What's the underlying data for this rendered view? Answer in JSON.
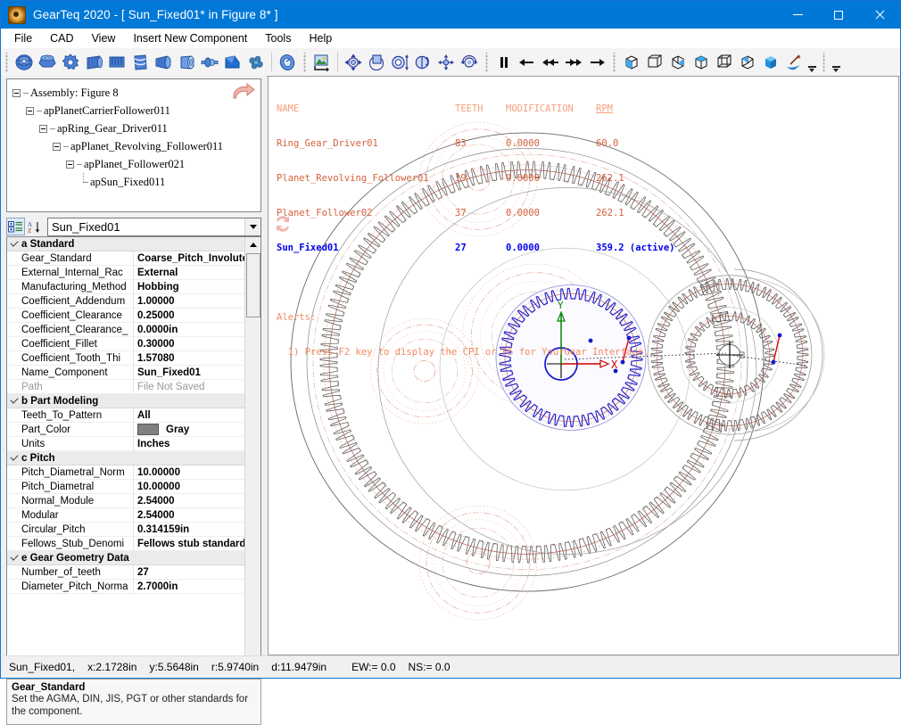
{
  "window": {
    "title": "GearTeq 2020 - [ Sun_Fixed01*  in  Figure 8* ]",
    "app_icon": "gear-app-icon",
    "minimize": "–",
    "maximize": "□",
    "close": "✕"
  },
  "menu": [
    "File",
    "CAD",
    "View",
    "Insert New Component",
    "Tools",
    "Help"
  ],
  "toolbars": {
    "gear_tools": [
      "spur-gear-icon",
      "bevel-gear-icon",
      "gear-pump-icon",
      "helical-gear-icon",
      "rack-icon",
      "worm-icon",
      "cylindrical-gear-icon",
      "ring-gear-icon",
      "shaft-icon",
      "bevel-pair-icon",
      "cluster-gear-icon",
      "face-gear-icon"
    ],
    "view_tools": [
      "render-image-icon",
      "fit-to-window-icon",
      "zoom-region-icon",
      "zoom-scale-icon",
      "rotate-view-icon",
      "pan-icon",
      "spin-icon"
    ],
    "animation_tools": [
      "pause-icon",
      "step-back-icon",
      "rewind-icon",
      "fast-forward-icon",
      "play-forward-icon"
    ],
    "orientation_tools": [
      "iso-view-icon",
      "front-view-icon",
      "right-view-icon",
      "top-view-icon",
      "back-view-icon",
      "left-view-icon",
      "solid-view-icon",
      "section-view-icon"
    ],
    "overflow": "toolbar-overflow-icon"
  },
  "tree": {
    "redo_icon": "redo-arrow-icon",
    "nodes": [
      {
        "label": "Assembly: Figure 8",
        "depth": 0,
        "expandable": true
      },
      {
        "label": "apPlanetCarrierFollower011",
        "depth": 1,
        "expandable": true
      },
      {
        "label": "apRing_Gear_Driver011",
        "depth": 2,
        "expandable": true
      },
      {
        "label": "apPlanet_Revolving_Follower011",
        "depth": 3,
        "expandable": true
      },
      {
        "label": "apPlanet_Follower021",
        "depth": 4,
        "expandable": true
      },
      {
        "label": "apSun_Fixed011",
        "depth": 5,
        "expandable": false
      }
    ]
  },
  "props_header": {
    "categorized_icon": "categorized-view-icon",
    "alphabetical_icon": "alphabetical-sort-icon",
    "component_value": "Sun_Fixed01",
    "dropdown_icon": "chevron-down-icon"
  },
  "property_grid": {
    "groups": [
      {
        "name": "a Standard",
        "rows": [
          {
            "name": "Gear_Standard",
            "value": "Coarse_Pitch_Involute_"
          },
          {
            "name": "External_Internal_Rac",
            "value": "External"
          },
          {
            "name": "Manufacturing_Method",
            "value": "Hobbing"
          },
          {
            "name": "Coefficient_Addendum",
            "value": "1.00000"
          },
          {
            "name": "Coefficient_Clearance",
            "value": "0.25000"
          },
          {
            "name": "Coefficient_Clearance_",
            "value": "0.0000in"
          },
          {
            "name": "Coefficient_Fillet",
            "value": "0.30000"
          },
          {
            "name": "Coefficient_Tooth_Thi",
            "value": "1.57080"
          },
          {
            "name": "Name_Component",
            "value": "Sun_Fixed01"
          },
          {
            "name": "Path",
            "value": "File Not Saved",
            "dim": true
          }
        ]
      },
      {
        "name": "b Part Modeling",
        "rows": [
          {
            "name": "Teeth_To_Pattern",
            "value": "All"
          },
          {
            "name": "Part_Color",
            "value": "Gray",
            "swatch": "#808080"
          },
          {
            "name": "Units",
            "value": "Inches"
          }
        ]
      },
      {
        "name": "c Pitch",
        "rows": [
          {
            "name": "Pitch_Diametral_Norm",
            "value": "10.00000"
          },
          {
            "name": "Pitch_Diametral",
            "value": "10.00000"
          },
          {
            "name": "Normal_Module",
            "value": "2.54000"
          },
          {
            "name": "Modular",
            "value": "2.54000"
          },
          {
            "name": "Circular_Pitch",
            "value": "0.314159in"
          },
          {
            "name": "Fellows_Stub_Denomi",
            "value": "Fellows stub standard i"
          }
        ]
      },
      {
        "name": "e Gear Geometry Data",
        "rows": [
          {
            "name": "Number_of_teeth",
            "value": "27"
          },
          {
            "name": "Diameter_Pitch_Norma",
            "value": "2.7000in"
          }
        ]
      }
    ]
  },
  "help": {
    "title": "Gear_Standard",
    "text": "Set the AGMA, DIN, JIS, PGT or other standards for the component."
  },
  "viewport": {
    "refresh_icon": "refresh-icon",
    "table": {
      "headers": [
        "NAME",
        "TEETH",
        "MODIFICATION",
        "RPM"
      ],
      "rows": [
        {
          "name": "Ring_Gear_Driver01",
          "teeth": "83",
          "modification": "0.0000",
          "rpm": "60.0",
          "active": false
        },
        {
          "name": "Planet_Revolving_Follower01",
          "teeth": "19",
          "modification": "0.0000",
          "rpm": "262.1",
          "active": false
        },
        {
          "name": "Planet_Follower02",
          "teeth": "37",
          "modification": "0.0000",
          "rpm": "262.1",
          "active": false
        },
        {
          "name": "Sun_Fixed01",
          "teeth": "27",
          "modification": "0.0000",
          "rpm": "359.2 (active)",
          "active": true
        }
      ]
    },
    "alerts_label": "Alerts:",
    "alerts": [
      "  1) Press F2 key to display the CPI or F5 for YourGear Interface."
    ],
    "axis_x_label": "X",
    "axis_y_label": "Y"
  },
  "statusbar": {
    "component": "Sun_Fixed01,",
    "x": "x:2.1728in",
    "y": "y:5.5648in",
    "r": "r:5.9740in",
    "d": "d:11.9479in",
    "ew": "EW:= 0.0",
    "ns": "NS:= 0.0"
  },
  "colors": {
    "titlebar": "#0078d7",
    "active_gear": "#0000ee",
    "header_text": "#f5a07a",
    "data_text": "#d4603a",
    "axis_x": "#cc0000",
    "axis_y": "#008800"
  }
}
